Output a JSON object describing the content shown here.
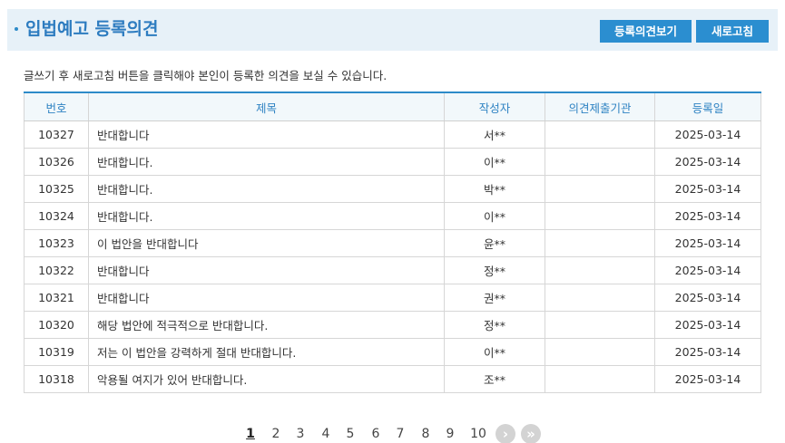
{
  "header": {
    "title": "입법예고 등록의견",
    "view_button": "등록의견보기",
    "refresh_button": "새로고침"
  },
  "notice": "글쓰기 후 새로고침 버튼을 클릭해야 본인이 등록한 의견을 보실 수 있습니다.",
  "table": {
    "columns": [
      "번호",
      "제목",
      "작성자",
      "의견제출기관",
      "등록일"
    ],
    "rows": [
      {
        "no": "10327",
        "title": "반대합니다",
        "author": "서**",
        "org": "",
        "date": "2025-03-14"
      },
      {
        "no": "10326",
        "title": "반대합니다.",
        "author": "이**",
        "org": "",
        "date": "2025-03-14"
      },
      {
        "no": "10325",
        "title": "반대합니다.",
        "author": "박**",
        "org": "",
        "date": "2025-03-14"
      },
      {
        "no": "10324",
        "title": "반대합니다.",
        "author": "이**",
        "org": "",
        "date": "2025-03-14"
      },
      {
        "no": "10323",
        "title": "이 법안을 반대합니다",
        "author": "윤**",
        "org": "",
        "date": "2025-03-14"
      },
      {
        "no": "10322",
        "title": "반대합니다",
        "author": "정**",
        "org": "",
        "date": "2025-03-14"
      },
      {
        "no": "10321",
        "title": "반대합니다",
        "author": "권**",
        "org": "",
        "date": "2025-03-14"
      },
      {
        "no": "10320",
        "title": "해당 법안에 적극적으로 반대합니다.",
        "author": "정**",
        "org": "",
        "date": "2025-03-14"
      },
      {
        "no": "10319",
        "title": "저는 이 법안을 강력하게 절대 반대합니다.",
        "author": "이**",
        "org": "",
        "date": "2025-03-14"
      },
      {
        "no": "10318",
        "title": "악용될 여지가 있어 반대합니다.",
        "author": "조**",
        "org": "",
        "date": "2025-03-14"
      }
    ]
  },
  "pagination": {
    "pages": [
      "1",
      "2",
      "3",
      "4",
      "5",
      "6",
      "7",
      "8",
      "9",
      "10"
    ],
    "current": "1",
    "next_icon": "chevron-right-icon",
    "last_icon": "double-chevron-right-icon"
  },
  "colors": {
    "accent": "#2d8bc9",
    "button": "#2b8ed0",
    "header_band": "#e7f1f8",
    "header_text": "#2f83c3"
  }
}
